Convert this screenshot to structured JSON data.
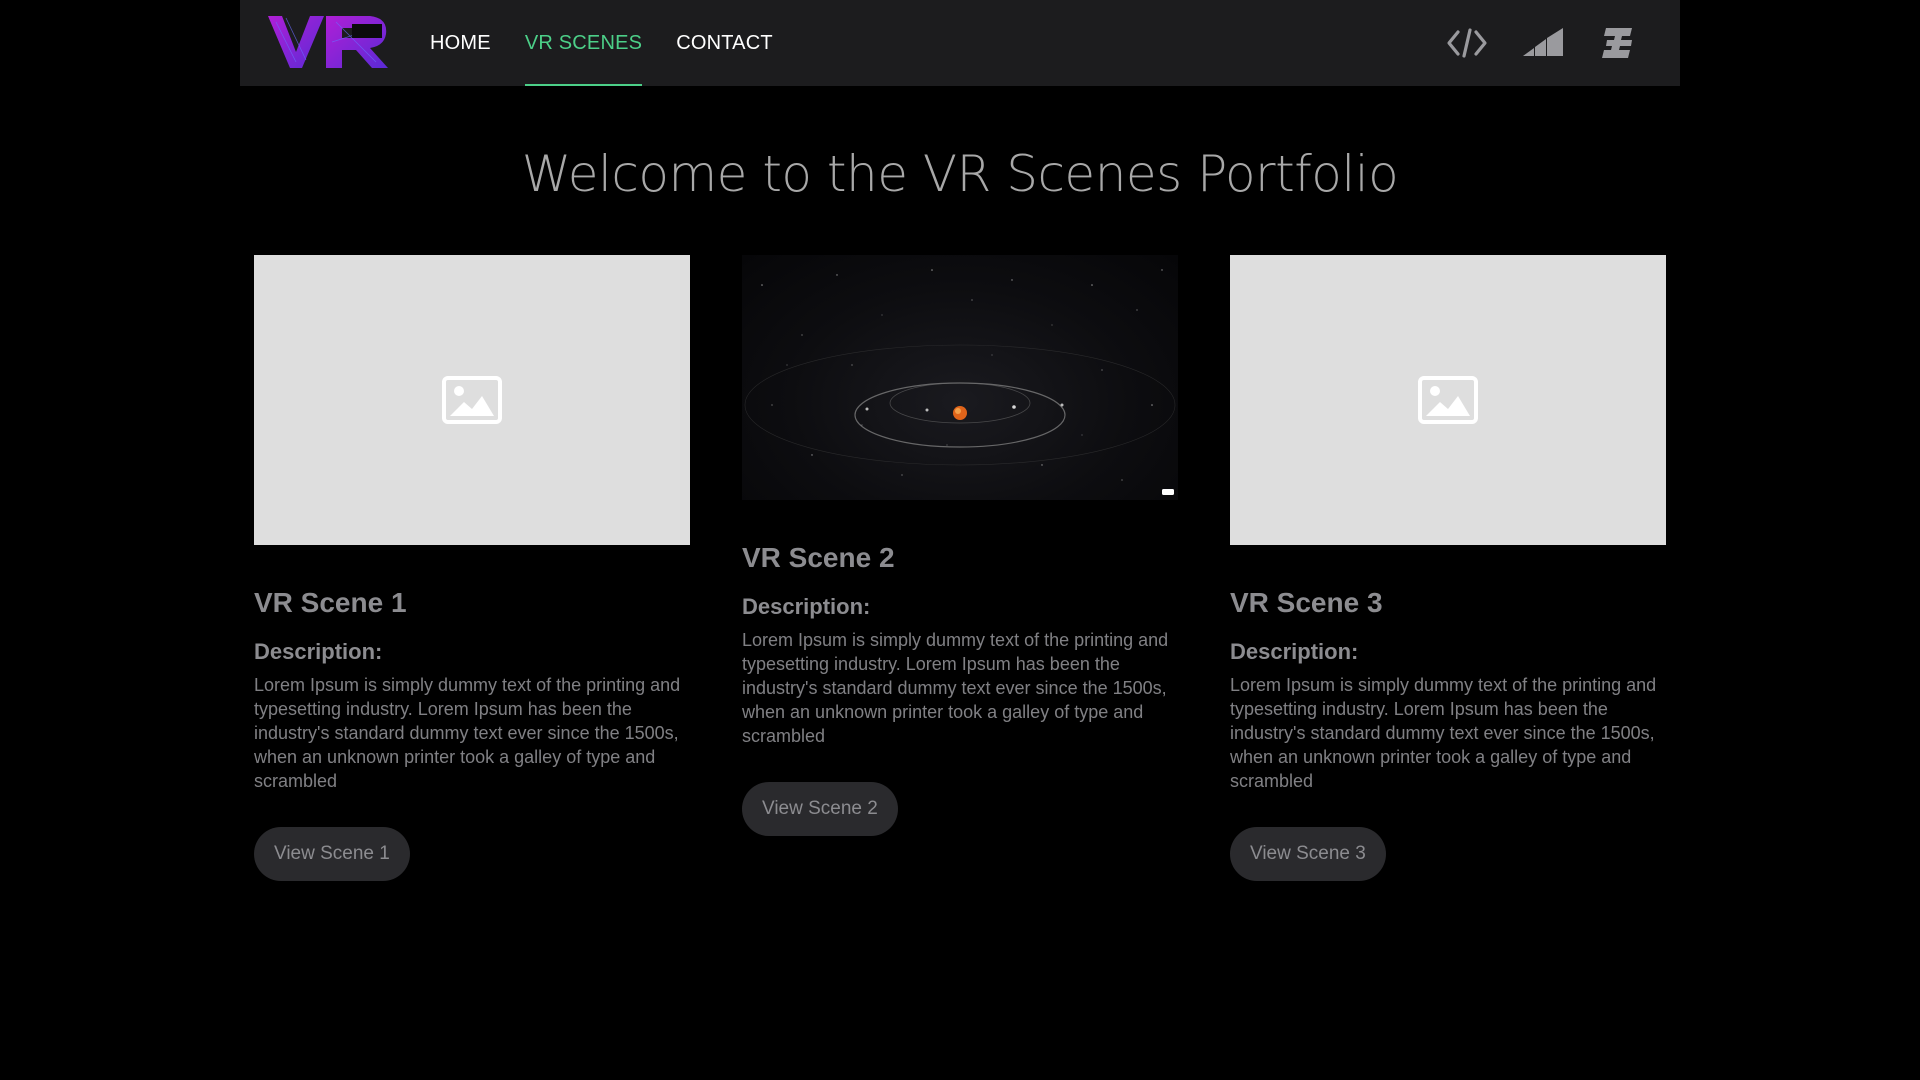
{
  "nav": {
    "items": [
      {
        "label": "HOME"
      },
      {
        "label": "VR SCENES"
      },
      {
        "label": "CONTACT"
      }
    ],
    "active_color": "#4ccf88",
    "icons": [
      "code-icon",
      "signal-bars-icon",
      "brand-b-icon"
    ]
  },
  "page": {
    "title": "Welcome to the VR Scenes Portfolio"
  },
  "cards": [
    {
      "title": "VR Scene 1",
      "thumbnail": "image-placeholder-icon",
      "description_heading": "Description:",
      "description": "Lorem Ipsum is simply dummy text of the printing and typesetting industry. Lorem Ipsum has been the industry's standard dummy text ever since the 1500s, when an unknown printer took a galley of type and scrambled",
      "button": "View Scene 1"
    },
    {
      "title": "VR Scene 2",
      "thumbnail": "solar-system-preview",
      "description_heading": "Description:",
      "description": "Lorem Ipsum is simply dummy text of the printing and typesetting industry. Lorem Ipsum has been the industry's standard dummy text ever since the 1500s, when an unknown printer took a galley of type and scrambled",
      "button": "View Scene 2"
    },
    {
      "title": "VR Scene 3",
      "thumbnail": "image-placeholder-icon",
      "description_heading": "Description:",
      "description": "Lorem Ipsum is simply dummy text of the printing and typesetting industry. Lorem Ipsum has been the industry's standard dummy text ever since the 1500s, when an unknown printer took a galley of type and scrambled",
      "button": "View Scene 3"
    }
  ]
}
